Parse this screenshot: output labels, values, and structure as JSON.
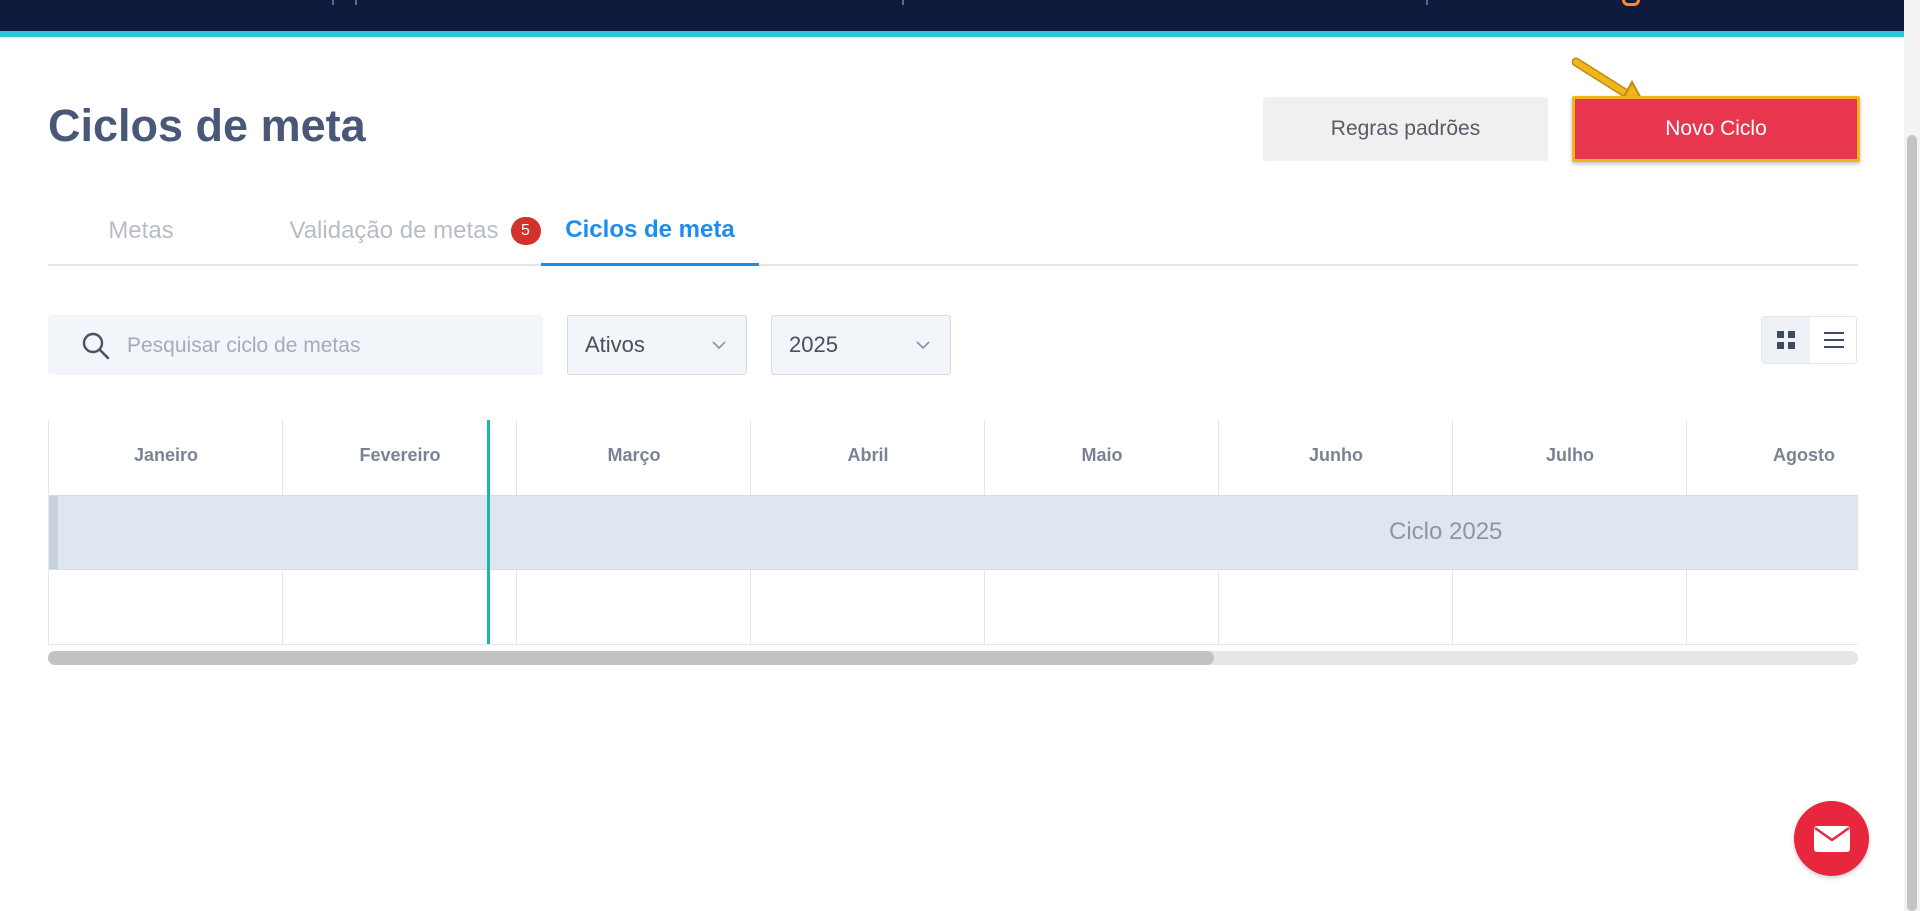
{
  "header": {
    "title": "Ciclos de meta",
    "rules_button": "Regras padrões",
    "new_cycle_button": "Novo Ciclo"
  },
  "tabs": [
    {
      "label": "Metas",
      "active": false
    },
    {
      "label": "Validação de metas",
      "badge": "5",
      "active": false
    },
    {
      "label": "Ciclos de meta",
      "active": true
    }
  ],
  "filters": {
    "search_placeholder": "Pesquisar ciclo de metas",
    "status_value": "Ativos",
    "year_value": "2025"
  },
  "timeline": {
    "months": [
      "Janeiro",
      "Fevereiro",
      "Março",
      "Abril",
      "Maio",
      "Junho",
      "Julho",
      "Agosto"
    ],
    "cycles": [
      {
        "label": "Ciclo 2025"
      }
    ]
  },
  "colors": {
    "top_bar": "#0e1b3d",
    "accent_line": "#2fc7d6",
    "primary_button": "#e8364f",
    "highlight_border": "#f1b51d",
    "active_tab": "#1d8ef0",
    "badge": "#d3312c",
    "today_line": "#17b8b0",
    "fab": "#e8263e"
  },
  "icons": {
    "search": "search-icon",
    "grid_view": "grid-view-icon",
    "list_view": "list-view-icon",
    "mail": "mail-icon",
    "chevron": "chevron-down-icon"
  }
}
